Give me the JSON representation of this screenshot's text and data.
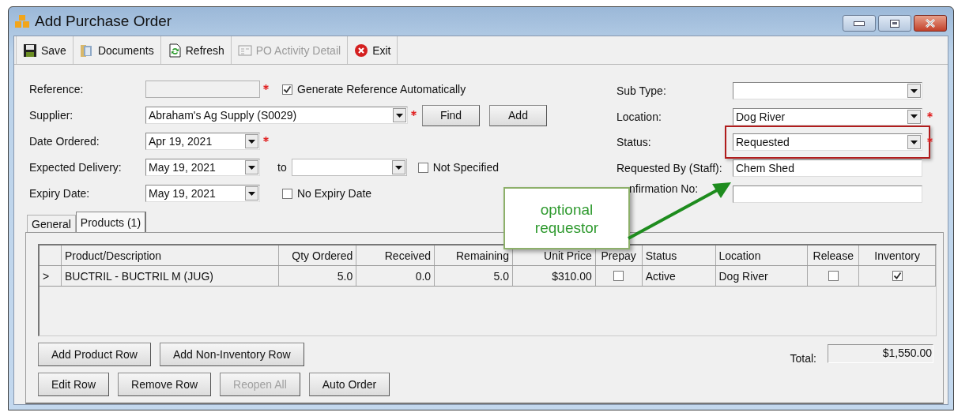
{
  "window": {
    "title": "Add Purchase Order"
  },
  "toolbar": [
    {
      "kind": "save",
      "label": "Save",
      "disabled": false
    },
    {
      "kind": "documents",
      "label": "Documents",
      "disabled": false
    },
    {
      "kind": "refresh",
      "label": "Refresh",
      "disabled": false
    },
    {
      "kind": "detail",
      "label": "PO Activity Detail",
      "disabled": true
    },
    {
      "kind": "exit",
      "label": "Exit",
      "disabled": false
    }
  ],
  "form_left": [
    {
      "label": "Reference:",
      "field": {
        "kind": "text",
        "disabled": true
      },
      "required": true,
      "extras": [
        {
          "kind": "checkbox",
          "label": "Generate Reference Automatically",
          "checked": true
        }
      ]
    },
    {
      "label": "Supplier:",
      "field": {
        "kind": "combo",
        "value": "Abraham's Ag Supply (S0029)"
      },
      "required": true,
      "extras": [
        {
          "kind": "button",
          "label": "Find"
        },
        {
          "kind": "button",
          "label": "Add"
        }
      ]
    },
    {
      "label": "Date Ordered:",
      "field": {
        "kind": "date",
        "value": "Apr 19, 2021"
      },
      "required": true
    },
    {
      "label": "Expected Delivery:",
      "field": {
        "kind": "date",
        "value": "May 19, 2021"
      },
      "required": false,
      "extras": [
        {
          "kind": "text",
          "label": "to"
        },
        {
          "kind": "combo"
        },
        {
          "kind": "checkbox",
          "label": "Not Specified",
          "checked": false
        }
      ]
    },
    {
      "label": "Expiry Date:",
      "field": {
        "kind": "date",
        "value": "May 19, 2021"
      },
      "required": false,
      "extras": [
        {
          "kind": "checkbox",
          "label": "No Expiry Date",
          "checked": false
        }
      ]
    }
  ],
  "form_right": [
    {
      "label": "Sub Type:",
      "field": {
        "kind": "combo"
      },
      "required": false,
      "highlighted": false
    },
    {
      "label": "Location:",
      "field": {
        "kind": "combo",
        "value": "Dog River"
      },
      "required": true,
      "highlighted": false
    },
    {
      "label": "Status:",
      "field": {
        "kind": "combo",
        "value": "Requested"
      },
      "required": true,
      "highlighted": true
    },
    {
      "label": "Requested By (Staff):",
      "field": {
        "kind": "text",
        "value": "Chem Shed"
      },
      "required": false,
      "highlighted": false
    },
    {
      "label": "nfirmation No:",
      "field": {
        "kind": "text"
      },
      "required": false,
      "highlighted": false
    }
  ],
  "tabs": [
    {
      "label": "General",
      "selected": false
    },
    {
      "label": "Products (1)",
      "selected": true
    }
  ],
  "table": {
    "columns": [
      {
        "label": "Product/Description",
        "kind": "text"
      },
      {
        "label": "Qty Ordered",
        "kind": "number"
      },
      {
        "label": "Received",
        "kind": "number"
      },
      {
        "label": "Remaining",
        "kind": "number"
      },
      {
        "label": "Unit Price",
        "kind": "number"
      },
      {
        "label": "Prepay",
        "kind": "check"
      },
      {
        "label": "Status",
        "kind": "text"
      },
      {
        "label": "Location",
        "kind": "text"
      },
      {
        "label": "Release",
        "kind": "check"
      },
      {
        "label": "Inventory",
        "kind": "check"
      }
    ],
    "rows": [
      {
        "marker": ">",
        "cells": [
          "BUCTRIL - BUCTRIL M (JUG)",
          "5.0",
          "0.0",
          "5.0",
          "$310.00",
          {
            "checked": false
          },
          "Active",
          "Dog River",
          {
            "checked": false
          },
          {
            "checked": true
          }
        ]
      }
    ]
  },
  "button_rows": [
    [
      {
        "label": "Add Product Row",
        "disabled": false
      },
      {
        "label": "Add Non-Inventory Row",
        "disabled": false
      }
    ],
    [
      {
        "label": "Edit Row",
        "disabled": false
      },
      {
        "label": "Remove Row",
        "disabled": false
      },
      {
        "label": "Reopen All",
        "disabled": true
      },
      {
        "label": "Auto Order",
        "disabled": false
      }
    ]
  ],
  "total": {
    "label": "Total:",
    "value": "$1,550.00"
  },
  "callout": {
    "text": "optional requestor"
  }
}
